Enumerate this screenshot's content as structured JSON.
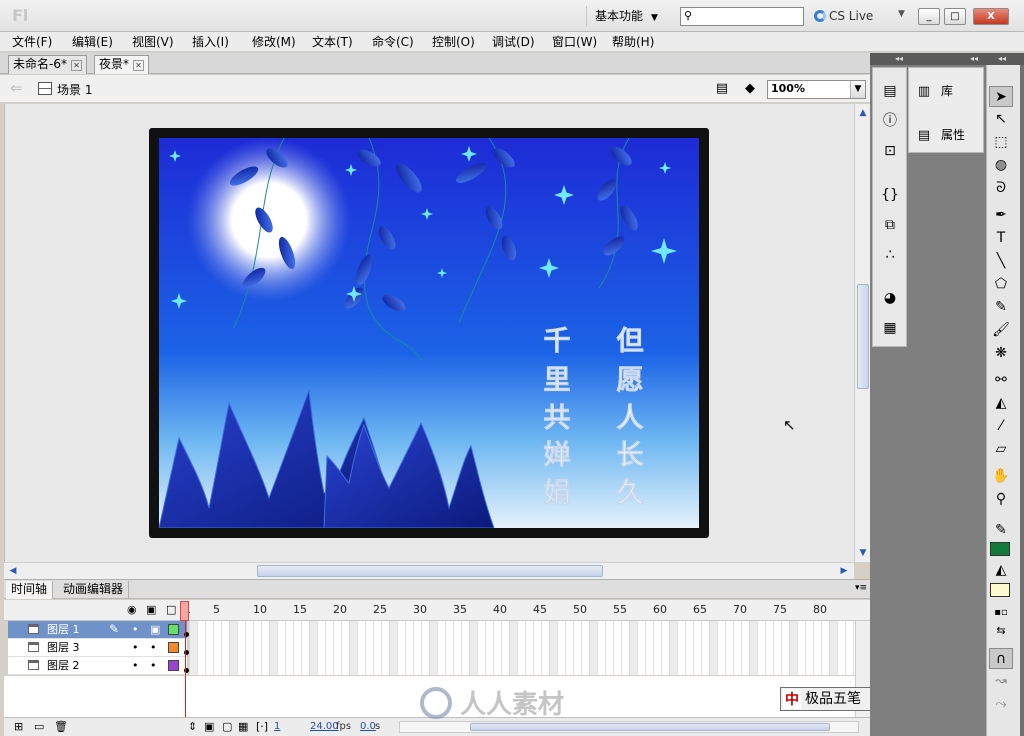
{
  "app": {
    "logo": "Fl",
    "workspace": "基本功能",
    "search_value": "",
    "cslive": "CS Live",
    "window_buttons": [
      "_",
      "□",
      "X"
    ]
  },
  "menu": [
    "文件(F)",
    "编辑(E)",
    "视图(V)",
    "插入(I)",
    "修改(M)",
    "文本(T)",
    "命令(C)",
    "控制(O)",
    "调试(D)",
    "窗口(W)",
    "帮助(H)"
  ],
  "tabs": [
    {
      "label": "未命名-6*",
      "active": false
    },
    {
      "label": "夜景*",
      "active": true
    }
  ],
  "editbar": {
    "scene": "场景 1",
    "zoom": "100%"
  },
  "artwork": {
    "left_column": [
      "千",
      "里",
      "共",
      "婵",
      "娟"
    ],
    "right_column": [
      "但",
      "愿",
      "人",
      "长",
      "久"
    ],
    "sky_top": "#1d2bd6",
    "sky_bottom": "#e6f2fb",
    "moon_color": "#ffffff",
    "star_color": "#6fe9f6"
  },
  "timeline": {
    "tabs": [
      "时间轴",
      "动画编辑器"
    ],
    "ruler": [
      "1",
      "5",
      "10",
      "15",
      "20",
      "25",
      "30",
      "35",
      "40",
      "45",
      "50",
      "55",
      "60",
      "65",
      "70",
      "75",
      "80"
    ],
    "layers": [
      {
        "name": "图层 1",
        "selected": true,
        "color": "#66e066"
      },
      {
        "name": "图层 3",
        "selected": false,
        "color": "#f08a2a"
      },
      {
        "name": "图层 2",
        "selected": false,
        "color": "#9944cc"
      }
    ],
    "footer": {
      "current_frame": "1",
      "fps": "24.00",
      "fps_unit": "fps",
      "seconds": "0.0",
      "seconds_unit": "s"
    }
  },
  "panels": {
    "library": "库",
    "properties": "属性"
  },
  "colors": {
    "stroke": "#127a3a",
    "fill": "#fffbd0"
  },
  "overlay": {
    "watermark": "人人素材",
    "ime_name": "极品五笔",
    "ime_icon": "中"
  }
}
